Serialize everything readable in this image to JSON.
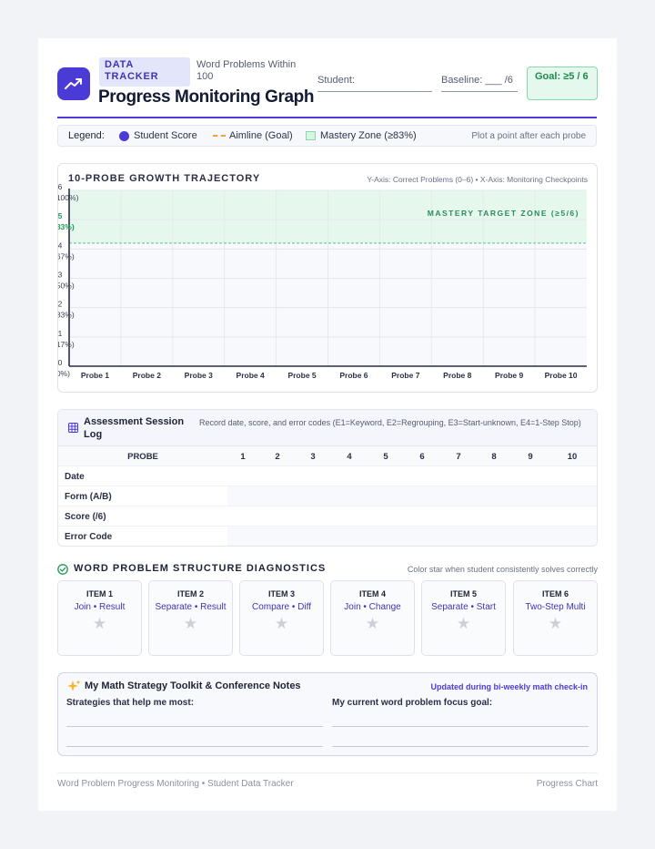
{
  "header": {
    "tag": "DATA TRACKER",
    "subtitle": "Word Problems Within 100",
    "title": "Progress Monitoring Graph",
    "student_label": "Student:",
    "baseline_label": "Baseline: ___ /6",
    "goal_label": "Goal: ≥5 / 6",
    "logo_icon": "trending-up-icon"
  },
  "legend": {
    "label": "Legend:",
    "items": [
      {
        "label": "Student Score",
        "icon": "dot",
        "color": "#4b3bd6"
      },
      {
        "label": "Aimline (Goal)",
        "icon": "dashed-line",
        "color": "#f2a23a"
      },
      {
        "label": "Mastery Zone (≥83%)",
        "icon": "green-box",
        "color": "#d6f5e2"
      }
    ],
    "hint": "Plot a point after each probe"
  },
  "chart_data": {
    "type": "line",
    "title": "10-PROBE GROWTH TRAJECTORY",
    "subtitle": "Y-Axis: Correct Problems (0–6) • X-Axis: Monitoring Checkpoints",
    "ylim": [
      0,
      6
    ],
    "y_ticks": [
      {
        "value": 6,
        "label": "6",
        "pct": "(100%)"
      },
      {
        "value": 5,
        "label": "5",
        "pct": "(83%)"
      },
      {
        "value": 4,
        "label": "4",
        "pct": "(67%)"
      },
      {
        "value": 3,
        "label": "3",
        "pct": "(50%)"
      },
      {
        "value": 2,
        "label": "2",
        "pct": "(33%)"
      },
      {
        "value": 1,
        "label": "1",
        "pct": "(17%)"
      },
      {
        "value": 0,
        "label": "0",
        "pct": "(0%)"
      }
    ],
    "categories": [
      "Probe 1",
      "Probe 2",
      "Probe 3",
      "Probe 4",
      "Probe 5",
      "Probe 6",
      "Probe 7",
      "Probe 8",
      "Probe 9",
      "Probe 10"
    ],
    "series": [],
    "mastery_zone": {
      "from": 4.2,
      "to": 6,
      "label": "MASTERY TARGET ZONE (≥5/6)",
      "color": "#e6f8ee",
      "line_color": "#4fc48b"
    },
    "grid": true
  },
  "log": {
    "title": "Assessment Session Log",
    "note": "Record date, score, and error codes (E1=Keyword, E2=Regrouping, E3=Start-unknown, E4=1-Step Stop)",
    "probe_header": "PROBE",
    "columns": [
      "1",
      "2",
      "3",
      "4",
      "5",
      "6",
      "7",
      "8",
      "9",
      "10"
    ],
    "rows": [
      "Date",
      "Form (A/B)",
      "Score (/6)",
      "Error Code"
    ]
  },
  "diagnostics": {
    "title": "WORD PROBLEM STRUCTURE DIAGNOSTICS",
    "note": "Color star when student consistently solves correctly",
    "items": [
      {
        "num": "ITEM 1",
        "name": "Join • Result"
      },
      {
        "num": "ITEM 2",
        "name": "Separate • Result"
      },
      {
        "num": "ITEM 3",
        "name": "Compare • Diff"
      },
      {
        "num": "ITEM 4",
        "name": "Join • Change"
      },
      {
        "num": "ITEM 5",
        "name": "Separate • Start"
      },
      {
        "num": "ITEM 6",
        "name": "Two-Step Multi"
      }
    ],
    "star": "★"
  },
  "toolkit": {
    "title": "My Math Strategy Toolkit & Conference Notes",
    "note": "Updated during bi-weekly math check-in",
    "left_label": "Strategies that help me most:",
    "right_label": "My current word problem focus goal:"
  },
  "footer": {
    "left": "Word Problem Progress Monitoring • Student Data Tracker",
    "right": "Progress Chart"
  }
}
